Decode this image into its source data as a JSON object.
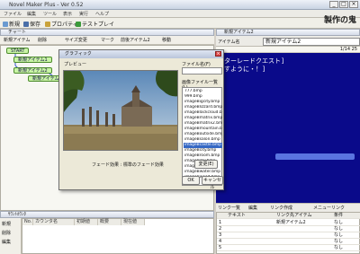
{
  "window": {
    "title": "Novel Maker Plus - Ver 0.52"
  },
  "menu": [
    "ファイル",
    "編集",
    "ツール",
    "表示",
    "実行",
    "ヘルプ"
  ],
  "toolbar": {
    "new": "新規",
    "save": "保存",
    "property": "プロパティ",
    "test_play": "テストプレイ"
  },
  "app_title": "製作の鬼",
  "tree_panel": {
    "title": "チャート",
    "buttons": [
      "新規アイテム",
      "削除",
      "サイズ変更",
      "マーク",
      "前後アイテム2",
      "移動"
    ],
    "nodes": [
      "START",
      "新規アイテム1",
      "新規アイテム2",
      "新規アイテム3"
    ]
  },
  "right_panel": {
    "title": "新規アイテム2",
    "name_label": "アイテム名",
    "name_value": "新規アイテム2",
    "position": "1/14 25",
    "lines": [
      "ンターレードクエスト]",
      "ますように・！]",
      "",
      "",
      "",
      "",
      "",
      "音"
    ]
  },
  "variable_panel": {
    "title": "ｻｳﾝﾄｶｳﾝﾀ",
    "buttons": [
      "新規",
      "削除",
      "編集"
    ],
    "columns": [
      "No.",
      "カウンタ名",
      "初期値",
      "概要",
      "現在値"
    ]
  },
  "link_panel": {
    "tabs": [
      "リンク一覧",
      "編集",
      "リンク作成",
      "メニューリンク"
    ],
    "columns": [
      "",
      "テキスト",
      "リンク先アイテム",
      "条件"
    ],
    "rows": [
      [
        "1",
        "",
        "新規アイテム2",
        "なし"
      ],
      [
        "2",
        "",
        "",
        "なし"
      ],
      [
        "3",
        "",
        "",
        "なし"
      ],
      [
        "4",
        "",
        "",
        "なし"
      ],
      [
        "5",
        "",
        "",
        "なし"
      ]
    ]
  },
  "dialog": {
    "title": "グラフィック",
    "preview_label": "プレビュー",
    "filename_label": "ファイル名(F)",
    "filename_value": "",
    "filelist_label": "画像ファイル一覧(L)",
    "files": [
      "777.bmp",
      "999.bmp",
      "imageBigcity.bmp",
      "imageBlizzard.bmp",
      "imageBlackcloud.bmp",
      "imageBmatrix.bmp",
      "imageBmatrix2.bmp",
      "imageBmountain.bmp",
      "imageBoutside.bmp",
      "imageBsalon.bmp",
      "imageBcastle.bmp",
      "imageBcity.bmp",
      "imageBroom.bmp",
      "imageBsky.bmp",
      "imageBsun.bmp",
      "imageBwater.bmp",
      "imageBwood.bmp"
    ],
    "selected_file_index": 10,
    "effect_text": "フェード効果 : 標準のフェード効果",
    "change_button": "変更(E)",
    "ok_button": "OK",
    "cancel_button": "キャンセル"
  },
  "colors": {
    "node_fill": "#c9f4a6",
    "editor_bg": "#0a0a8a",
    "selection": "#3568c4"
  }
}
